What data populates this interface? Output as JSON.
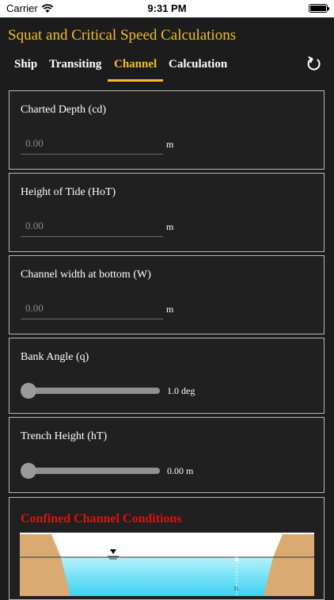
{
  "status_bar": {
    "carrier": "Carrier",
    "time": "9:31 PM"
  },
  "app": {
    "title": "Squat and Critical Speed Calculations"
  },
  "tabs": [
    {
      "label": "Ship"
    },
    {
      "label": "Transiting"
    },
    {
      "label": "Channel",
      "active": true
    },
    {
      "label": "Calculation"
    }
  ],
  "colors": {
    "accent": "#f0bf2a",
    "heading_red": "#e01010",
    "background": "#1c1c1c"
  },
  "icons": {
    "refresh": "refresh-icon",
    "wifi": "wifi-icon",
    "battery": "battery-icon"
  },
  "fields": {
    "charted_depth": {
      "label": "Charted Depth (cd)",
      "placeholder": "0.00",
      "unit": "m"
    },
    "height_of_tide": {
      "label": "Height of Tide (HoT)",
      "placeholder": "0.00",
      "unit": "m"
    },
    "channel_width": {
      "label": "Channel width at bottom (W)",
      "placeholder": "0.00",
      "unit": "m"
    }
  },
  "sliders": {
    "bank_angle": {
      "label": "Bank Angle (q)",
      "value_text": "1.0 deg",
      "position_fraction": 0
    },
    "trench_height": {
      "label": "Trench Height (hT)",
      "value_text": "0.00 m",
      "position_fraction": 0
    }
  },
  "confined": {
    "title": "Confined Channel Conditions",
    "h_label": "h"
  }
}
